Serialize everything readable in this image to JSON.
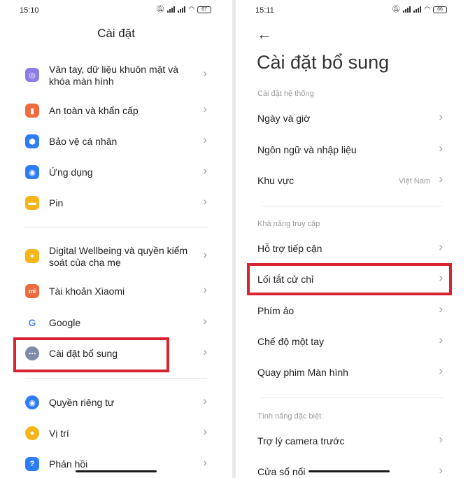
{
  "left_screen": {
    "status": {
      "time": "15:10",
      "battery": "67"
    },
    "title": "Cài đặt",
    "group1": [
      {
        "label": "Vân tay, dữ liệu khuôn mặt và khóa màn hình",
        "icon": "fingerprint-icon",
        "color": "#8d7be6",
        "glyph": "◎"
      },
      {
        "label": "An toàn và khẩn cấp",
        "icon": "emergency-icon",
        "color": "#ef6a3c",
        "glyph": "▮"
      },
      {
        "label": "Bảo vệ cá nhân",
        "icon": "shield-icon",
        "color": "#2f7df6",
        "glyph": "⬢"
      },
      {
        "label": "Ứng dụng",
        "icon": "apps-icon",
        "color": "#2f7df6",
        "glyph": "◉"
      },
      {
        "label": "Pin",
        "icon": "battery-icon",
        "color": "#f5b418",
        "glyph": "▬"
      }
    ],
    "group2": [
      {
        "label": "Digital Wellbeing và quyền kiểm soát của cha mẹ",
        "icon": "wellbeing-icon",
        "color": "#f5b418",
        "glyph": "●"
      },
      {
        "label": "Tài khoản Xiaomi",
        "icon": "xiaomi-icon",
        "color": "#ef6a3c",
        "glyph": "mi"
      },
      {
        "label": "Google",
        "icon": "google-icon",
        "color": "#ffffff",
        "glyph": "G"
      },
      {
        "label": "Cài đặt bổ sung",
        "icon": "more-icon",
        "color": "#7e8aa8",
        "glyph": "⋯"
      }
    ],
    "group3": [
      {
        "label": "Quyền riêng tư",
        "icon": "eye-icon",
        "color": "#2f7df6",
        "glyph": "◉"
      },
      {
        "label": "Vị trí",
        "icon": "location-icon",
        "color": "#f5b418",
        "glyph": "●"
      },
      {
        "label": "Phản hồi",
        "icon": "feedback-icon",
        "color": "#2f7df6",
        "glyph": "?"
      }
    ]
  },
  "right_screen": {
    "status": {
      "time": "15:11",
      "battery": "66"
    },
    "back_glyph": "←",
    "title": "Cài đặt bổ sung",
    "section_system": "Cài đặt hệ thống",
    "system_items": [
      {
        "label": "Ngày và giờ",
        "value": ""
      },
      {
        "label": "Ngôn ngữ và nhập liệu",
        "value": ""
      },
      {
        "label": "Khu vực",
        "value": "Việt Nam"
      }
    ],
    "section_access": "Khả năng truy cập",
    "access_items": [
      {
        "label": "Hỗ trợ tiếp cận"
      },
      {
        "label": "Lối tắt cử chỉ"
      },
      {
        "label": "Phím ảo"
      },
      {
        "label": "Chế độ một tay"
      },
      {
        "label": "Quay phim Màn hình"
      }
    ],
    "section_special": "Tính năng đặc biệt",
    "special_items": [
      {
        "label": "Trợ lý camera trước"
      },
      {
        "label": "Cửa sổ nổi"
      }
    ]
  },
  "chevron": "›",
  "highlight_color": "#d62531"
}
